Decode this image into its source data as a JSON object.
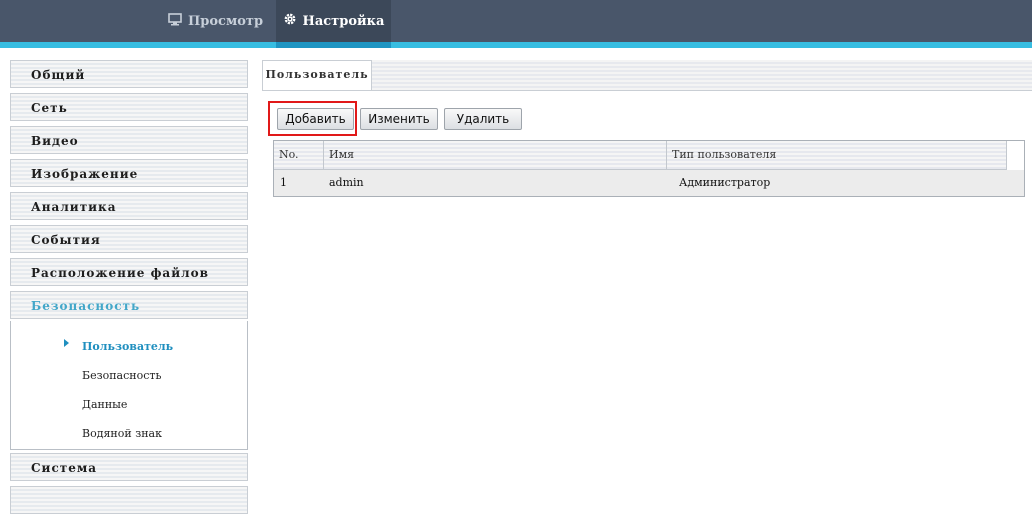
{
  "topnav": {
    "tabs": [
      {
        "label": "Просмотр",
        "icon": "monitor-icon"
      },
      {
        "label": "Настройка",
        "icon": "gear-icon"
      }
    ],
    "active": "Настройка",
    "colors": {
      "bar": "#49566a",
      "accent": "#37bde1"
    }
  },
  "sidebar": {
    "items": [
      {
        "label": "Общий"
      },
      {
        "label": "Сеть"
      },
      {
        "label": "Видео"
      },
      {
        "label": "Изображение"
      },
      {
        "label": "Аналитика"
      },
      {
        "label": "События"
      },
      {
        "label": "Расположение файлов"
      },
      {
        "label": "Безопасность"
      },
      {
        "label": "Система"
      }
    ],
    "active": "Безопасность",
    "submenu": [
      {
        "label": "Пользователь"
      },
      {
        "label": "Безопасность"
      },
      {
        "label": "Данные"
      },
      {
        "label": "Водяной знак"
      }
    ],
    "submenu_active": "Пользователь"
  },
  "content": {
    "tab_label": "Пользователь",
    "buttons": {
      "add": "Добавить",
      "edit": "Изменить",
      "delete": "Удалить"
    },
    "table": {
      "headers": [
        "No.",
        "Имя",
        "Тип пользователя"
      ],
      "rows": [
        {
          "no": "1",
          "name": "admin",
          "type": "Администратор"
        }
      ]
    }
  }
}
